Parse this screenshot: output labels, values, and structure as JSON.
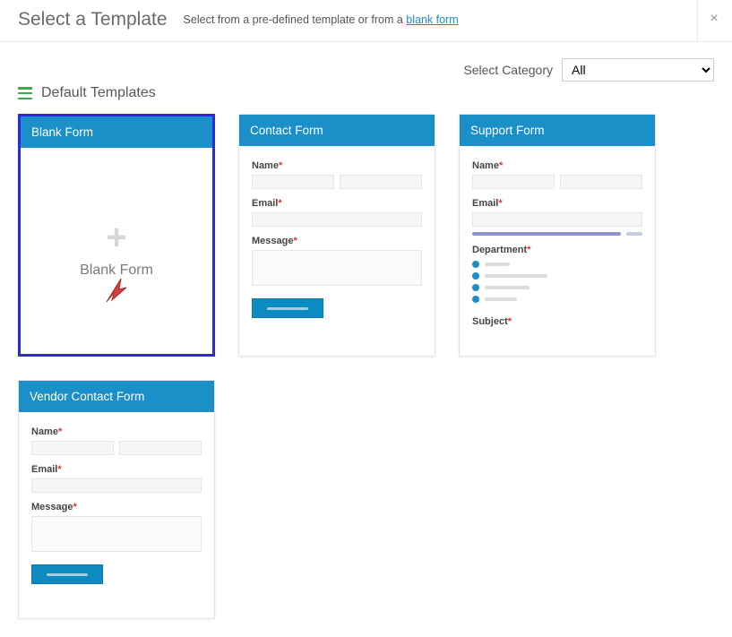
{
  "header": {
    "title": "Select a Template",
    "subtitle_prefix": "Select from a pre-defined template or from a ",
    "blank_link": "blank form"
  },
  "close_label": "×",
  "category": {
    "label": "Select Category",
    "selected": "All",
    "options": [
      "All"
    ]
  },
  "section": {
    "title": "Default Templates"
  },
  "cards": {
    "blank": {
      "title": "Blank Form",
      "body_label": "Blank Form"
    },
    "contact": {
      "title": "Contact Form",
      "fields": {
        "name": "Name",
        "email": "Email",
        "message": "Message"
      }
    },
    "support": {
      "title": "Support Form",
      "fields": {
        "name": "Name",
        "email": "Email",
        "department": "Department",
        "subject": "Subject"
      }
    },
    "vendor": {
      "title": "Vendor Contact Form",
      "fields": {
        "name": "Name",
        "email": "Email",
        "message": "Message"
      }
    }
  }
}
